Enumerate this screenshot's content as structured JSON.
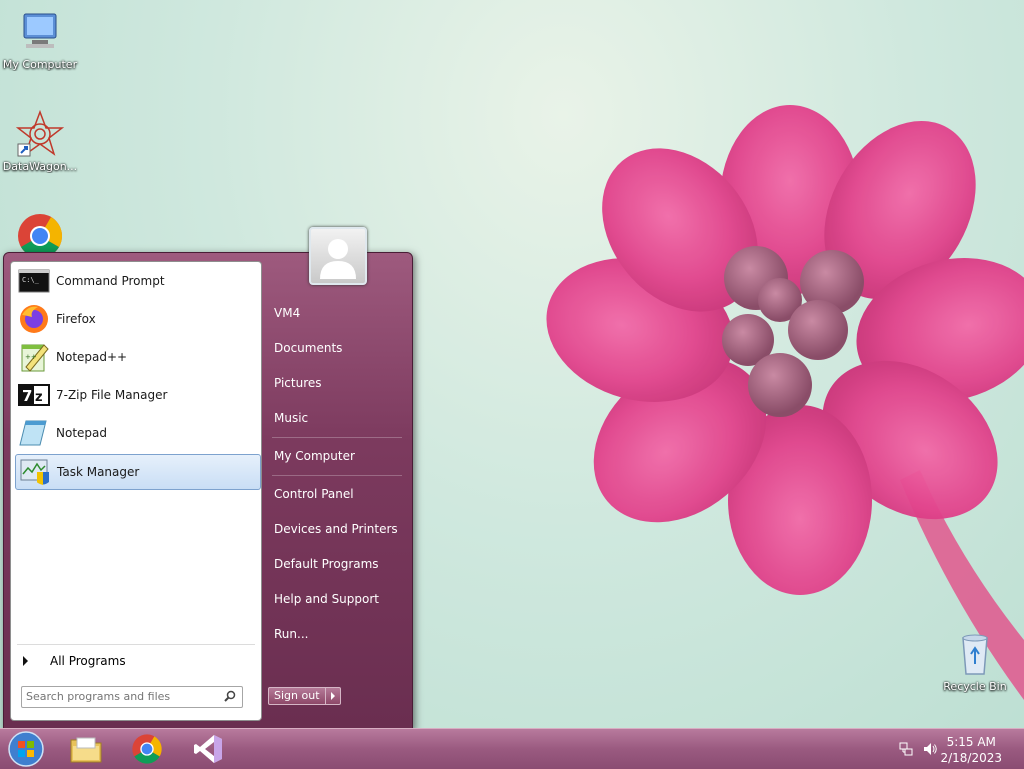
{
  "desktop": {
    "icons": [
      {
        "label": "My Computer",
        "icon": "computer-icon"
      },
      {
        "label": "DataWagon...",
        "icon": "datawagon-icon"
      },
      {
        "label": "",
        "icon": "chrome-icon"
      },
      {
        "label": "Recycle Bin",
        "icon": "recycle-bin-icon"
      }
    ]
  },
  "start_menu": {
    "programs": [
      {
        "label": "Command Prompt",
        "icon": "command-prompt-icon"
      },
      {
        "label": "Firefox",
        "icon": "firefox-icon"
      },
      {
        "label": "Notepad++",
        "icon": "notepad-plus-plus-icon"
      },
      {
        "label": "7-Zip File Manager",
        "icon": "7zip-icon"
      },
      {
        "label": "Notepad",
        "icon": "notepad-icon"
      },
      {
        "label": "Task Manager",
        "icon": "task-manager-icon",
        "highlighted": true
      }
    ],
    "all_programs": "All Programs",
    "search_placeholder": "Search programs and files",
    "right_links": [
      "VM4",
      "Documents",
      "Pictures",
      "Music",
      "My Computer",
      "Control Panel",
      "Devices and Printers",
      "Default Programs",
      "Help and Support",
      "Run..."
    ],
    "sign_out": "Sign out"
  },
  "taskbar": {
    "pinned": [
      {
        "icon": "start-orb-icon"
      },
      {
        "icon": "file-explorer-icon"
      },
      {
        "icon": "chrome-icon"
      },
      {
        "icon": "visual-studio-icon"
      }
    ],
    "time": "5:15 AM",
    "date": "2/18/2023"
  },
  "colors": {
    "start_menu_accent": "#7c3a5e",
    "taskbar": "#9a5a80",
    "highlight": "#c9def5"
  }
}
